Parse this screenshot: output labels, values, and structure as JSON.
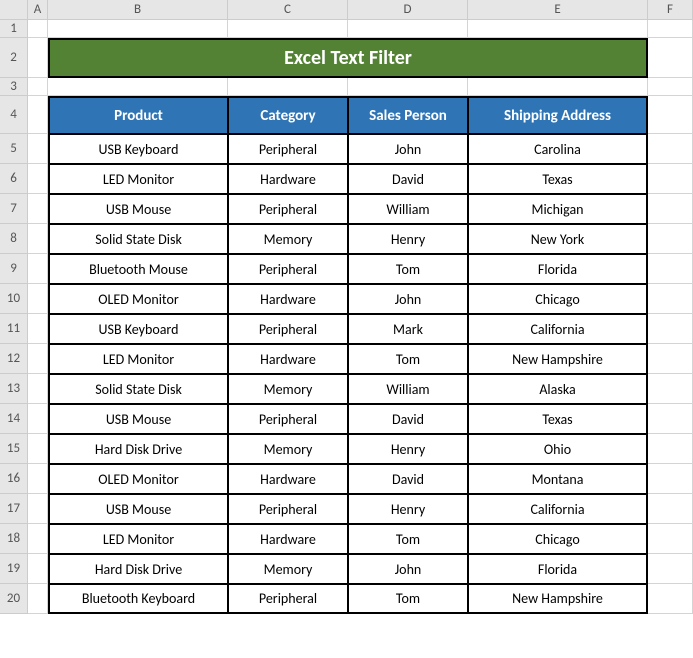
{
  "columns": [
    "A",
    "B",
    "C",
    "D",
    "E",
    "F"
  ],
  "rowNumbers": [
    1,
    2,
    3,
    4,
    5,
    6,
    7,
    8,
    9,
    10,
    11,
    12,
    13,
    14,
    15,
    16,
    17,
    18,
    19,
    20
  ],
  "title": "Excel Text Filter",
  "headers": {
    "product": "Product",
    "category": "Category",
    "salesPerson": "Sales Person",
    "shippingAddress": "Shipping Address"
  },
  "rows": [
    {
      "product": "USB Keyboard",
      "category": "Peripheral",
      "salesPerson": "John",
      "shippingAddress": "Carolina"
    },
    {
      "product": "LED Monitor",
      "category": "Hardware",
      "salesPerson": "David",
      "shippingAddress": "Texas"
    },
    {
      "product": "USB Mouse",
      "category": "Peripheral",
      "salesPerson": "William",
      "shippingAddress": "Michigan"
    },
    {
      "product": "Solid State Disk",
      "category": "Memory",
      "salesPerson": "Henry",
      "shippingAddress": "New York"
    },
    {
      "product": "Bluetooth Mouse",
      "category": "Peripheral",
      "salesPerson": "Tom",
      "shippingAddress": "Florida"
    },
    {
      "product": "OLED Monitor",
      "category": "Hardware",
      "salesPerson": "John",
      "shippingAddress": "Chicago"
    },
    {
      "product": "USB Keyboard",
      "category": "Peripheral",
      "salesPerson": "Mark",
      "shippingAddress": "California"
    },
    {
      "product": "LED Monitor",
      "category": "Hardware",
      "salesPerson": "Tom",
      "shippingAddress": "New Hampshire"
    },
    {
      "product": "Solid State Disk",
      "category": "Memory",
      "salesPerson": "William",
      "shippingAddress": "Alaska"
    },
    {
      "product": "USB Mouse",
      "category": "Peripheral",
      "salesPerson": "David",
      "shippingAddress": "Texas"
    },
    {
      "product": "Hard Disk Drive",
      "category": "Memory",
      "salesPerson": "Henry",
      "shippingAddress": "Ohio"
    },
    {
      "product": "OLED Monitor",
      "category": "Hardware",
      "salesPerson": "David",
      "shippingAddress": "Montana"
    },
    {
      "product": "USB Mouse",
      "category": "Peripheral",
      "salesPerson": "Henry",
      "shippingAddress": "California"
    },
    {
      "product": "LED Monitor",
      "category": "Hardware",
      "salesPerson": "Tom",
      "shippingAddress": "Chicago"
    },
    {
      "product": "Hard Disk Drive",
      "category": "Memory",
      "salesPerson": "John",
      "shippingAddress": "Florida"
    },
    {
      "product": "Bluetooth Keyboard",
      "category": "Peripheral",
      "salesPerson": "Tom",
      "shippingAddress": "New Hampshire"
    }
  ]
}
